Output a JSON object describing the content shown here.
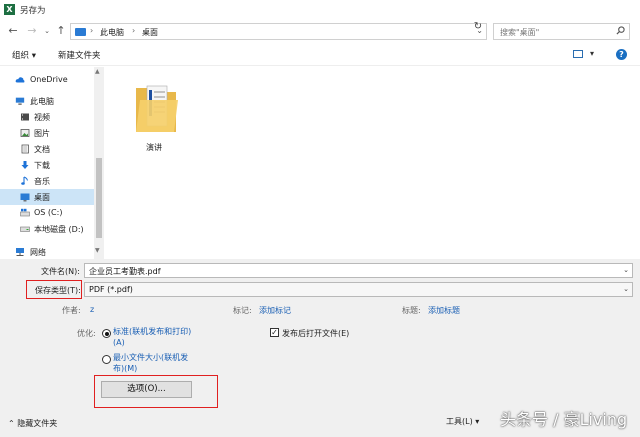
{
  "window": {
    "title": "另存为",
    "app_icon_letter": "X"
  },
  "navigation": {
    "breadcrumb": [
      "此电脑",
      "桌面"
    ],
    "search_placeholder": "搜索\"桌面\""
  },
  "toolbar": {
    "organize": "组织 ▾",
    "new_folder": "新建文件夹"
  },
  "sidebar": {
    "items": [
      {
        "label": "OneDrive",
        "icon": "cloud-icon"
      },
      {
        "label": "此电脑",
        "icon": "computer-icon"
      },
      {
        "label": "视频",
        "icon": "video-icon"
      },
      {
        "label": "图片",
        "icon": "picture-icon"
      },
      {
        "label": "文档",
        "icon": "document-icon"
      },
      {
        "label": "下载",
        "icon": "download-icon"
      },
      {
        "label": "音乐",
        "icon": "music-icon"
      },
      {
        "label": "桌面",
        "icon": "desktop-icon",
        "selected": true
      },
      {
        "label": "OS (C:)",
        "icon": "drive-icon"
      },
      {
        "label": "本地磁盘 (D:)",
        "icon": "drive-icon"
      },
      {
        "label": "网络",
        "icon": "network-icon"
      }
    ]
  },
  "files": [
    {
      "name": "演讲",
      "icon": "folder-icon"
    }
  ],
  "form": {
    "filename_label": "文件名(N):",
    "filename_value": "企业员工考勤表.pdf",
    "filetype_label": "保存类型(T):",
    "filetype_value": "PDF (*.pdf)",
    "author_label": "作者:",
    "author_value": "z",
    "tags_label": "标记:",
    "tags_link": "添加标记",
    "title_label": "标题:",
    "title_link": "添加标题",
    "optimize_label": "优化:",
    "optimize_standard_line1": "标准(联机发布和打印)",
    "optimize_standard_line2": "(A)",
    "optimize_min_line1": "最小文件大小(联机发",
    "optimize_min_line2": "布)(M)",
    "open_after_publish": "发布后打开文件(E)",
    "options_button": "选项(O)..."
  },
  "footer": {
    "hide_folders": "隐藏文件夹",
    "tools": "工具(L)",
    "watermark": "头条号 / 豪Living"
  },
  "colors": {
    "accent": "#1a5fb4",
    "selection": "#cce4f7",
    "highlight_box": "#e02020"
  }
}
